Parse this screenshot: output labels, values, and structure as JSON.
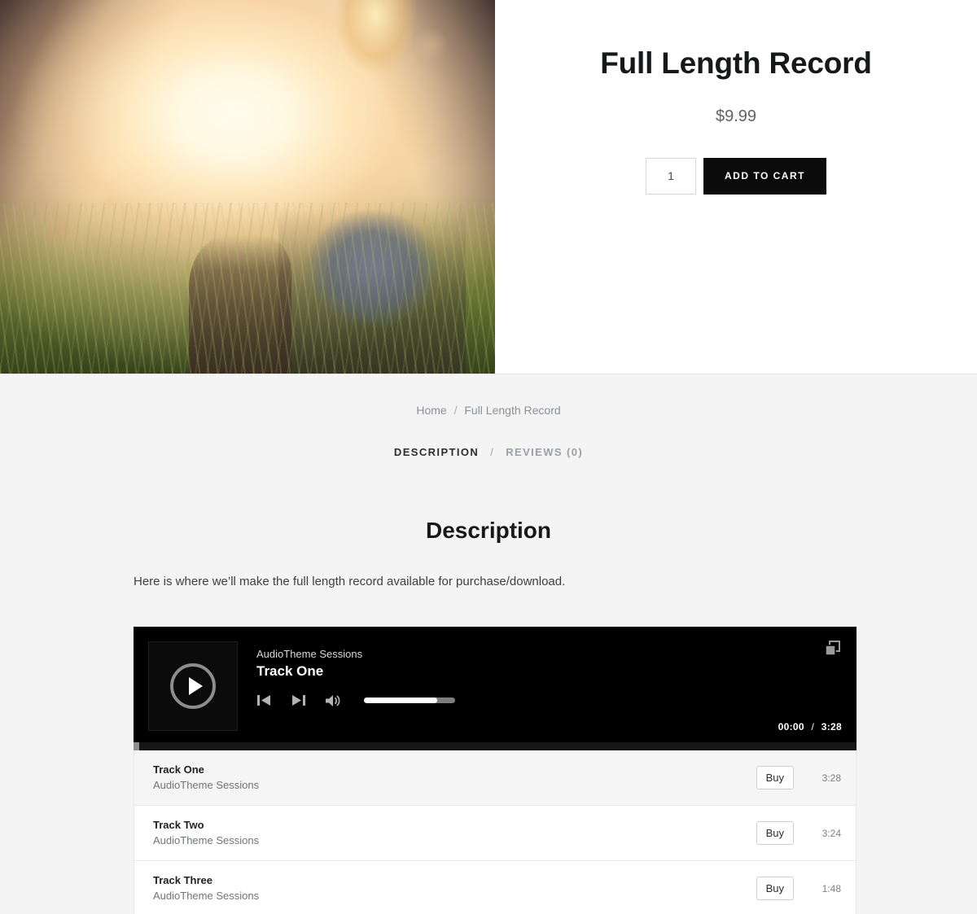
{
  "product": {
    "title": "Full Length Record",
    "price": "$9.99",
    "quantity_value": "1",
    "quantity_placeholder": "1",
    "add_to_cart_label": "ADD TO CART",
    "image_alt": "Sunset field photograph"
  },
  "breadcrumb": {
    "home_label": "Home",
    "separator": "/",
    "current_label": "Full Length Record"
  },
  "tabs": {
    "separator": "/",
    "items": [
      {
        "label": "DESCRIPTION",
        "active": true
      },
      {
        "label": "REVIEWS (0)",
        "active": false
      }
    ]
  },
  "description": {
    "heading": "Description",
    "body": "Here is where we’ll make the full length record available for purchase/download."
  },
  "player": {
    "artist": "AudioTheme Sessions",
    "track": "Track One",
    "current_time": "00:00",
    "time_separator": "/",
    "total_time": "3:28",
    "volume_percent": 80,
    "progress_percent": 0,
    "icons": {
      "play": "play-icon",
      "previous": "previous-track-icon",
      "next": "next-track-icon",
      "volume": "volume-icon",
      "playlist": "playlist-toggle-icon"
    }
  },
  "tracklist": {
    "buy_label": "Buy",
    "tracks": [
      {
        "title": "Track One",
        "artist": "AudioTheme Sessions",
        "duration": "3:28",
        "buy_label": "Buy",
        "active": true
      },
      {
        "title": "Track Two",
        "artist": "AudioTheme Sessions",
        "duration": "3:24",
        "buy_label": "Buy",
        "active": false
      },
      {
        "title": "Track Three",
        "artist": "AudioTheme Sessions",
        "duration": "1:48",
        "buy_label": "Buy",
        "active": false
      }
    ]
  },
  "colors": {
    "page_background": "#ffffff",
    "section_background": "#f4f4f4",
    "accent_dark": "#0b0b0b",
    "player_background": "#000000",
    "active_row": "#f5f5f5",
    "muted_text": "#8b9096"
  }
}
